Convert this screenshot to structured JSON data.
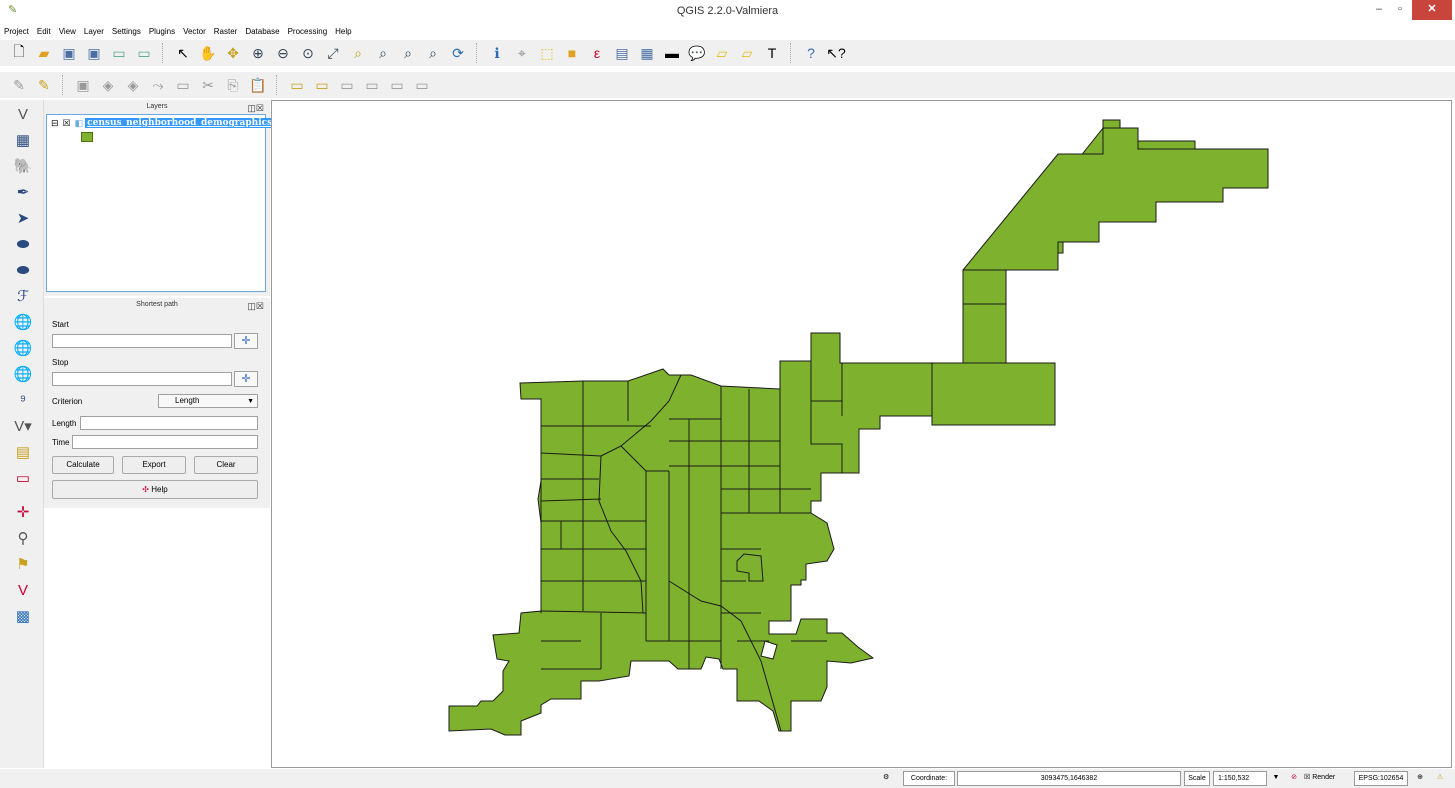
{
  "window": {
    "title": "QGIS 2.2.0-Valmiera",
    "minimize": "–",
    "maximize": "▫",
    "close": "✕"
  },
  "menu": [
    "Project",
    "Edit",
    "View",
    "Layer",
    "Settings",
    "Plugins",
    "Vector",
    "Raster",
    "Database",
    "Processing",
    "Help"
  ],
  "layers_panel": {
    "title": "Layers",
    "layer_name": "census_neighborhood_demographics...",
    "fill_color": "#7eb12e"
  },
  "shortest_path": {
    "title": "Shortest path",
    "start_label": "Start",
    "stop_label": "Stop",
    "criterion_label": "Criterion",
    "criterion_value": "Length",
    "length_label": "Length",
    "time_label": "Time",
    "calculate_label": "Calculate",
    "export_label": "Export",
    "clear_label": "Clear",
    "help_label": "Help"
  },
  "map": {
    "fill_color": "#7eb12e",
    "stroke_color": "#1a1a1a"
  },
  "status": {
    "coordinate_label": "Coordinate:",
    "coordinate_value": "3093475,1646382",
    "scale_label": "Scale",
    "scale_value": "1:150,532",
    "render_label": "Render",
    "crs_value": "EPSG:102654"
  },
  "icons": {
    "toolbar1": [
      "new-project-icon",
      "open-project-icon",
      "save-project-icon",
      "save-as-icon",
      "new-print-composer-icon",
      "composer-manager-icon",
      "touch-zoom-icon",
      "pan-icon",
      "pan-to-selection-icon",
      "zoom-in-icon",
      "zoom-out-icon",
      "zoom-native-icon",
      "zoom-full-icon",
      "zoom-to-selection-icon",
      "zoom-to-layer-icon",
      "zoom-last-icon",
      "zoom-next-icon",
      "refresh-icon",
      "identify-icon",
      "measure-icon",
      "select-icon",
      "deselect-icon",
      "expression-select-icon",
      "attribute-table-icon",
      "field-calculator-icon",
      "measure-line-icon",
      "map-tips-icon",
      "new-bookmark-icon",
      "show-bookmarks-icon",
      "text-annotation-icon",
      "help-icon",
      "whats-this-icon"
    ],
    "toolbar2": [
      "edits-icon",
      "toggle-editing-icon",
      "save-edits-icon",
      "add-feature-icon",
      "move-feature-icon",
      "node-tool-icon",
      "delete-selected-icon",
      "cut-features-icon",
      "copy-features-icon",
      "paste-features-icon",
      "label-icon",
      "label-pin-icon",
      "label-show-hide-icon",
      "label-move-icon",
      "label-rotate-icon",
      "label-change-icon"
    ],
    "left": [
      "add-vector-layer-icon",
      "add-raster-layer-icon",
      "add-postgis-layer-icon",
      "add-spatialite-layer-icon",
      "add-mssql-layer-icon",
      "add-oracle-layer-icon",
      "add-sqlanywhere-layer-icon",
      "add-delimited-text-layer-icon",
      "add-wms-layer-icon",
      "add-wcs-layer-icon",
      "add-wfs-layer-icon",
      "add-gps-layer-icon",
      "new-shapefile-layer-icon",
      "new-spatialite-layer-icon",
      "remove-layer-icon",
      "coordinate-capture-icon",
      "georeferencer-icon",
      "gps-tools-icon",
      "topology-checker-icon",
      "heatmap-icon"
    ]
  }
}
